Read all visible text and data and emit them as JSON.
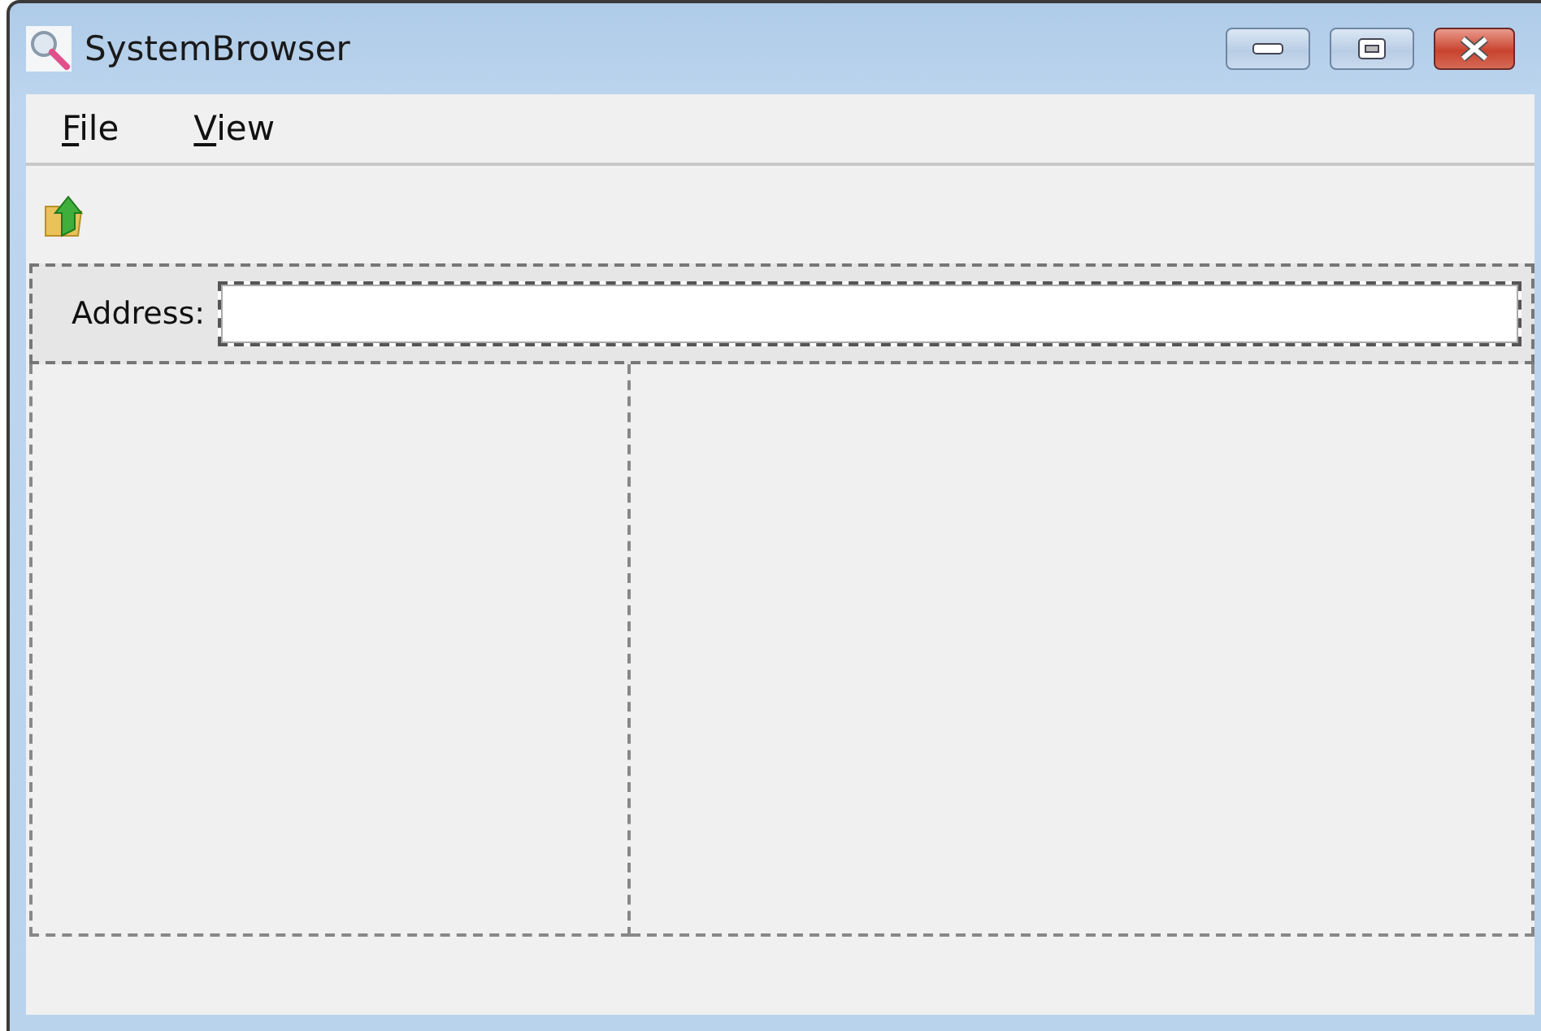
{
  "window": {
    "title": "SystemBrowser"
  },
  "menu": [
    {
      "label": "File"
    },
    {
      "label": "View"
    }
  ],
  "address": {
    "label": "Address:"
  }
}
